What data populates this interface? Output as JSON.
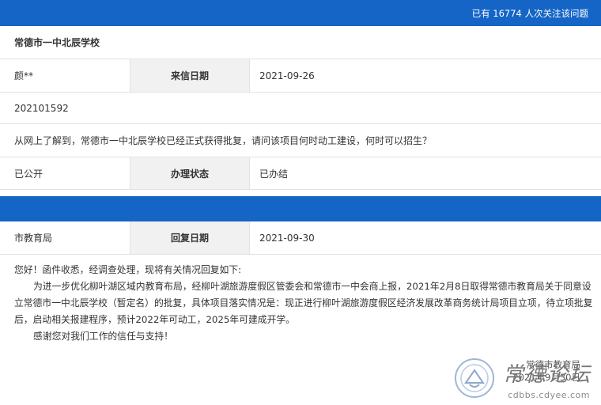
{
  "header": {
    "attention_text": "已有 16774 人次关注该问题"
  },
  "letter": {
    "unit": "常德市一中北辰学校",
    "sender": "颜**",
    "date_label": "来信日期",
    "date": "2021-09-26",
    "number": "202101592",
    "content": "从网上了解到，常德市一中北辰学校已经正式获得批复，请问该项目何时动工建设，何时可以招生？",
    "visibility": "已公开",
    "status_label": "办理状态",
    "status": "已办结"
  },
  "reply": {
    "department": "市教育局",
    "date_label": "回复日期",
    "date": "2021-09-30",
    "greeting": "您好！函件收悉，经调查处理，现将有关情况回复如下:",
    "paragraph": "为进一步优化柳叶湖区域内教育布局，经柳叶湖旅游度假区管委会和常德市一中会商上报，2021年2月8日取得常德市教育局关于同意设立常德市一中北辰学校（暂定名）的批复，具体项目落实情况是：现正进行柳叶湖旅游度假区经济发展改革商务统计局项目立项，待立项批复后，启动相关报建程序，预计2022年可动工，2025年可建成开学。",
    "thanks": "感谢您对我们工作的信任与支持！",
    "sign_org": "常德市教育局",
    "sign_date": "2021年9月30日"
  },
  "watermark": {
    "title": "常德论坛",
    "url": "cdbbs.cdyee.com"
  }
}
